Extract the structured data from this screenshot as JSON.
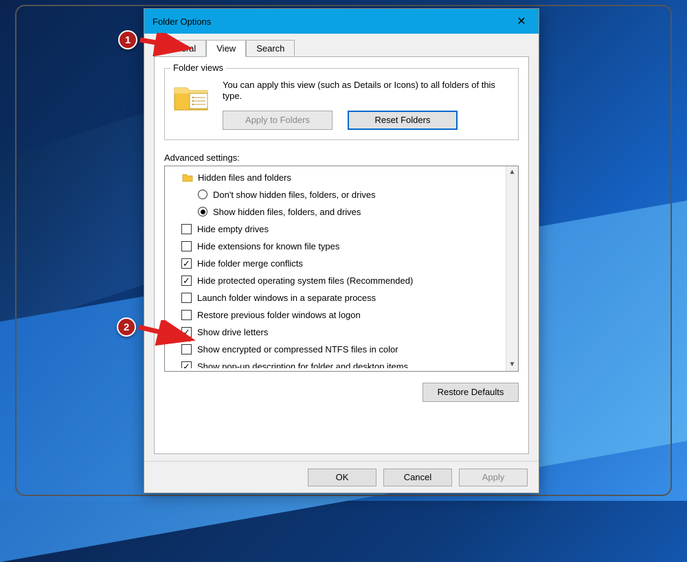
{
  "window": {
    "title": "Folder Options",
    "close": "✕"
  },
  "tabs": {
    "general": "General",
    "view": "View",
    "search": "Search"
  },
  "folder_views": {
    "legend": "Folder views",
    "text": "You can apply this view (such as Details or Icons) to all folders of this type.",
    "apply": "Apply to Folders",
    "reset": "Reset Folders"
  },
  "advanced": {
    "label": "Advanced settings:",
    "items": [
      {
        "type": "folder",
        "label": "Hidden files and folders"
      },
      {
        "type": "radio",
        "checked": false,
        "indent": 2,
        "label": "Don't show hidden files, folders, or drives"
      },
      {
        "type": "radio",
        "checked": true,
        "indent": 2,
        "label": "Show hidden files, folders, and drives"
      },
      {
        "type": "check",
        "checked": false,
        "label": "Hide empty drives"
      },
      {
        "type": "check",
        "checked": false,
        "label": "Hide extensions for known file types"
      },
      {
        "type": "check",
        "checked": true,
        "label": "Hide folder merge conflicts"
      },
      {
        "type": "check",
        "checked": true,
        "label": "Hide protected operating system files (Recommended)"
      },
      {
        "type": "check",
        "checked": false,
        "label": "Launch folder windows in a separate process"
      },
      {
        "type": "check",
        "checked": false,
        "label": "Restore previous folder windows at logon"
      },
      {
        "type": "check",
        "checked": true,
        "label": "Show drive letters"
      },
      {
        "type": "check",
        "checked": false,
        "label": "Show encrypted or compressed NTFS files in color"
      },
      {
        "type": "check",
        "checked": true,
        "label": "Show pop-up description for folder and desktop items"
      }
    ],
    "restore_defaults": "Restore Defaults"
  },
  "buttons": {
    "ok": "OK",
    "cancel": "Cancel",
    "apply": "Apply"
  },
  "annotations": {
    "b1": "1",
    "b2": "2"
  }
}
